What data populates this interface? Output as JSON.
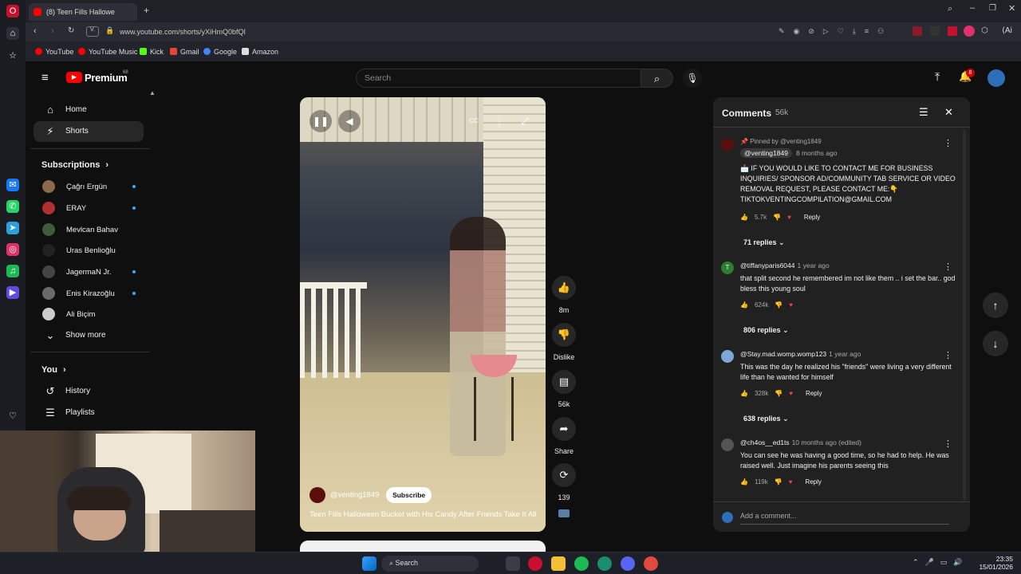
{
  "browser": {
    "tab_title": "(8) Teen Fills Hallowe",
    "url": "www.youtube.com/shorts/yXiHmQ0bfQI",
    "view_badge": "V.",
    "ai_label": "Ai",
    "bookmarks": [
      {
        "label": "YouTube",
        "color": "#ff0000"
      },
      {
        "label": "YouTube Music",
        "color": "#ff0000"
      },
      {
        "label": "Kick",
        "color": "#53fc18"
      },
      {
        "label": "Gmail",
        "color": "#ea4335"
      },
      {
        "label": "Google",
        "color": "#4285f4"
      },
      {
        "label": "Amazon",
        "color": "#dddddd"
      }
    ]
  },
  "youtube": {
    "logo_text": "Premium",
    "logo_badge": "68",
    "search_placeholder": "Search",
    "notification_count": "8",
    "sidebar": {
      "home": "Home",
      "shorts": "Shorts",
      "subscriptions_title": "Subscriptions",
      "subscriptions": [
        {
          "name": "Çağrı Ergün",
          "color": "#8a6a4a"
        },
        {
          "name": "ERAY",
          "color": "#b03030"
        },
        {
          "name": "Mevlcan Bahav",
          "color": "#3b5b3b"
        },
        {
          "name": "Uras Benlioğlu",
          "color": "#222222"
        },
        {
          "name": "JagermaN Jr.",
          "color": "#444444"
        },
        {
          "name": "Enis Kirazoğlu",
          "color": "#6a6a6a"
        },
        {
          "name": "Ali Biçim",
          "color": "#cccccc"
        }
      ],
      "show_more": "Show more",
      "you_title": "You",
      "history": "History",
      "playlists": "Playlists"
    },
    "video": {
      "channel": "@venting1849",
      "subscribe": "Subscribe",
      "title": "Teen Fills Halloween Bucket with His Candy After Friends Take It All"
    },
    "actions": {
      "likes": "8m",
      "dislike": "Dislike",
      "comments": "56k",
      "share": "Share",
      "remix": "139"
    },
    "comments_panel": {
      "title": "Comments",
      "count": "56k",
      "add_placeholder": "Add a comment...",
      "comments": [
        {
          "pinned": "Pinned by @venting1849",
          "author": "@venting1849",
          "time": "8 months ago",
          "text": "📩 IF YOU WOULD LIKE TO CONTACT ME FOR BUSINESS INQUIRIES/ SPONSOR AD/COMMUNITY TAB SERVICE OR VIDEO REMOVAL REQUEST, PLEASE CONTACT ME:👇 TIKTOKVENTINGCOMPILATION@GMAIL.COM",
          "likes": "5.7k",
          "reply": "Reply",
          "replies": "71 replies",
          "avatar_color": "#5a0e0e"
        },
        {
          "author": "@tiffanyparis6044",
          "time": "1 year ago",
          "text": "that split second he remembered im not like them .. i set the bar.. god bless this young soul",
          "likes": "624k",
          "replies": "806 replies",
          "avatar_color": "#2e7d32",
          "initial": "T"
        },
        {
          "author": "@Stay.mad.womp.womp123",
          "time": "1 year ago",
          "text": "This was the day he realized his \"friends\" were living a very different life than he wanted for himself",
          "likes": "328k",
          "reply": "Reply",
          "replies": "638 replies",
          "avatar_color": "#7fa7d8"
        },
        {
          "author": "@ch4os__ed1ts",
          "time": "10 months ago (edited)",
          "text": "You can see he was having a good time, so he had to help. He was raised well. Just imagine his parents seeing this",
          "likes": "119k",
          "reply": "Reply",
          "avatar_color": "#555555"
        }
      ]
    }
  },
  "taskbar": {
    "search": "Search",
    "time": "23:35",
    "date": "15/01/2026"
  }
}
